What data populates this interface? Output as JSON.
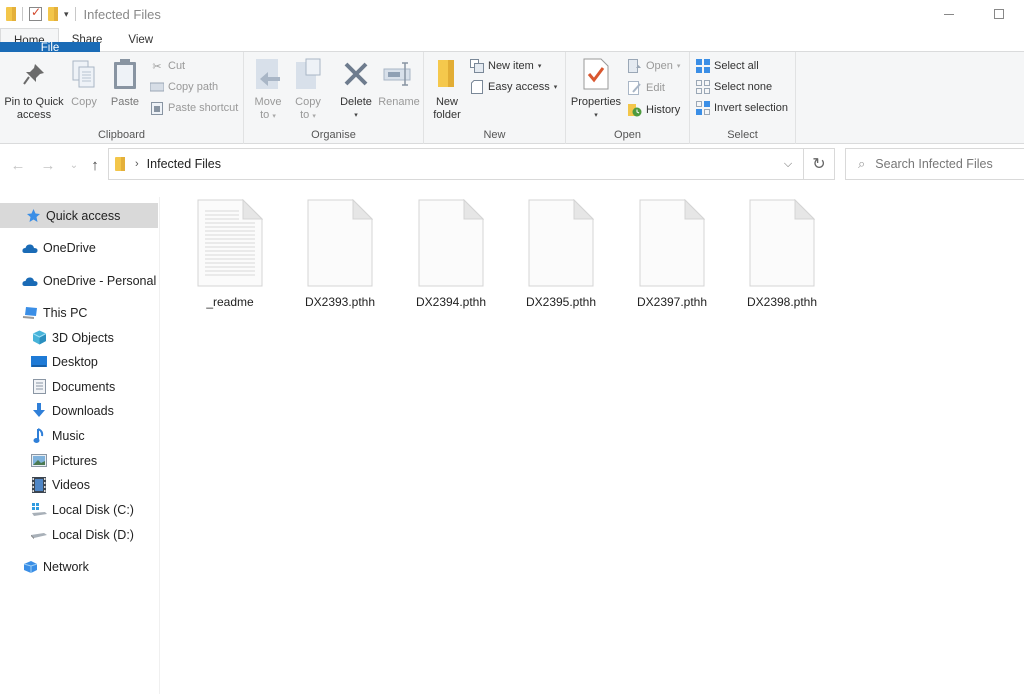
{
  "window": {
    "title": "Infected Files"
  },
  "tabs": [
    {
      "label": "File"
    },
    {
      "label": "Home"
    },
    {
      "label": "Share"
    },
    {
      "label": "View"
    }
  ],
  "ribbon": {
    "clipboard": {
      "label": "Clipboard",
      "pin": "Pin to Quick",
      "pin2": "access",
      "copy": "Copy",
      "paste": "Paste",
      "cut": "Cut",
      "copy_path": "Copy path",
      "paste_shortcut": "Paste shortcut"
    },
    "organise": {
      "label": "Organise",
      "move": "Move",
      "move2": "to",
      "copy": "Copy",
      "copy2": "to",
      "delete": "Delete",
      "rename": "Rename"
    },
    "new": {
      "label": "New",
      "new_folder": "New",
      "new_folder2": "folder",
      "new_item": "New item",
      "easy_access": "Easy access"
    },
    "open": {
      "label": "Open",
      "properties": "Properties",
      "open": "Open",
      "edit": "Edit",
      "history": "History"
    },
    "select": {
      "label": "Select",
      "select_all": "Select all",
      "select_none": "Select none",
      "invert": "Invert selection"
    }
  },
  "address": {
    "path": "Infected Files"
  },
  "search": {
    "placeholder": "Search Infected Files"
  },
  "sidebar": {
    "items": [
      {
        "label": "Quick access",
        "icon": "star-icon"
      },
      {
        "label": "OneDrive",
        "icon": "cloud-icon"
      },
      {
        "label": "OneDrive - Personal",
        "icon": "cloud-icon"
      },
      {
        "label": "This PC",
        "icon": "computer-icon"
      },
      {
        "label": "3D Objects",
        "icon": "cube-icon"
      },
      {
        "label": "Desktop",
        "icon": "desktop-icon"
      },
      {
        "label": "Documents",
        "icon": "document-icon"
      },
      {
        "label": "Downloads",
        "icon": "download-icon"
      },
      {
        "label": "Music",
        "icon": "music-icon"
      },
      {
        "label": "Pictures",
        "icon": "picture-icon"
      },
      {
        "label": "Videos",
        "icon": "video-icon"
      },
      {
        "label": "Local Disk (C:)",
        "icon": "drive-c-icon"
      },
      {
        "label": "Local Disk (D:)",
        "icon": "drive-icon"
      },
      {
        "label": "Network",
        "icon": "network-icon"
      }
    ]
  },
  "files": [
    {
      "name": "_readme",
      "type": "text"
    },
    {
      "name": "DX2393.pthh",
      "type": "blank"
    },
    {
      "name": "DX2394.pthh",
      "type": "blank"
    },
    {
      "name": "DX2395.pthh",
      "type": "blank"
    },
    {
      "name": "DX2397.pthh",
      "type": "blank"
    },
    {
      "name": "DX2398.pthh",
      "type": "blank"
    }
  ],
  "colors": {
    "accent": "#1a6bb6",
    "selection": "#d9d9d9",
    "folder": "#f3c64a"
  }
}
